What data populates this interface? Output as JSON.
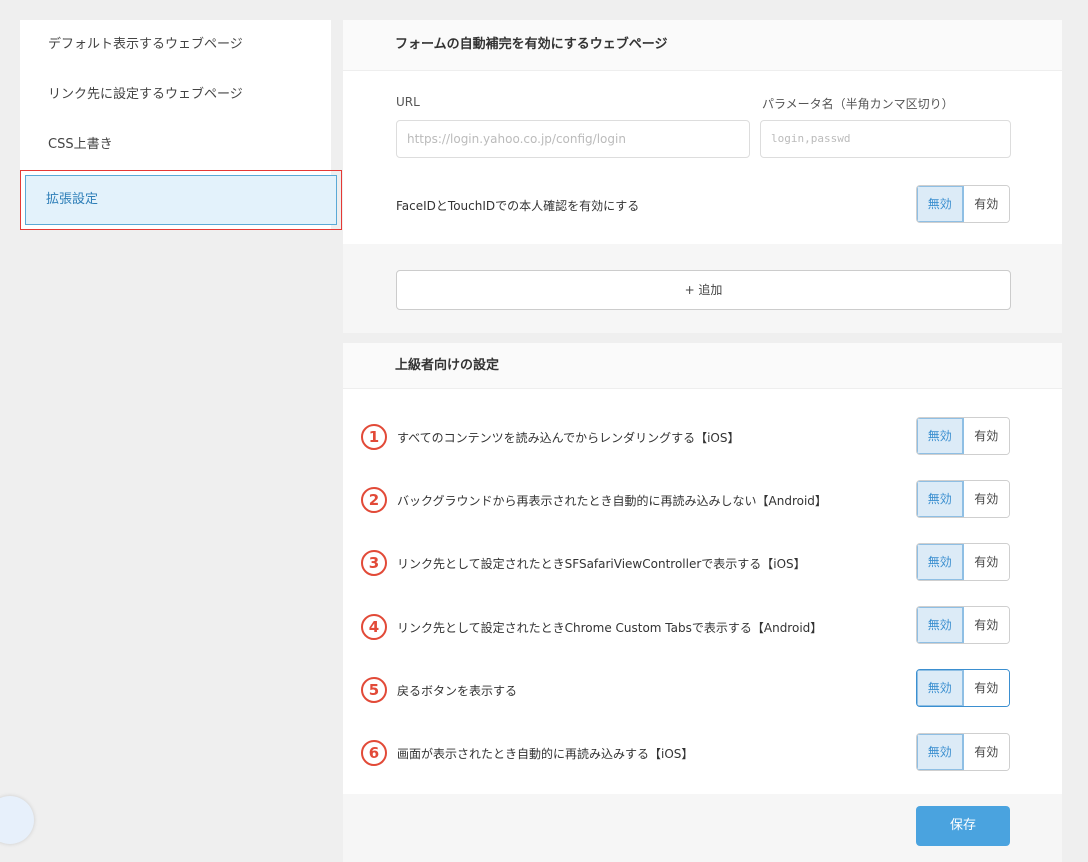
{
  "sidebar": {
    "items": [
      {
        "label": "デフォルト表示するウェブページ"
      },
      {
        "label": "リンク先に設定するウェブページ"
      },
      {
        "label": "CSS上書き"
      },
      {
        "label": "拡張設定"
      }
    ]
  },
  "form_autofill": {
    "title": "フォームの自動補完を有効にするウェブページ",
    "url_label": "URL",
    "url_placeholder": "https://login.yahoo.co.jp/config/login",
    "param_label": "パラメータ名（半角カンマ区切り）",
    "param_placeholder": "login,passwd",
    "faceid_label": "FaceIDとTouchIDでの本人確認を有効にする",
    "off_label": "無効",
    "on_label": "有効",
    "add_label": "+ 追加"
  },
  "advanced": {
    "title": "上級者向けの設定",
    "rows": [
      {
        "num": "1",
        "label": "すべてのコンテンツを読み込んでからレンダリングする【iOS】"
      },
      {
        "num": "2",
        "label": "バックグラウンドから再表示されたとき自動的に再読み込みしない【Android】"
      },
      {
        "num": "3",
        "label": "リンク先として設定されたときSFSafariViewControllerで表示する【iOS】"
      },
      {
        "num": "4",
        "label": "リンク先として設定されたときChrome Custom Tabsで表示する【Android】"
      },
      {
        "num": "5",
        "label": "戻るボタンを表示する"
      },
      {
        "num": "6",
        "label": "画面が表示されたとき自動的に再読み込みする【iOS】"
      }
    ],
    "off_label": "無効",
    "on_label": "有効",
    "save_label": "保存"
  },
  "colors": {
    "accent": "#4aa3df",
    "highlight": "#e53935",
    "annotation": "#e24a38"
  }
}
